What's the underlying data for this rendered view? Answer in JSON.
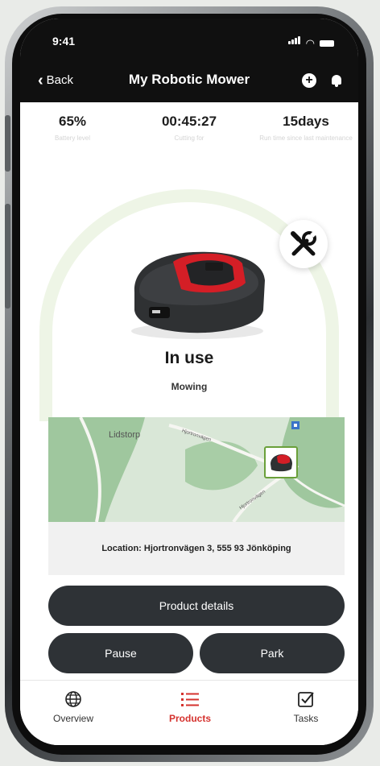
{
  "status_bar": {
    "time": "9:41"
  },
  "nav": {
    "back_label": "Back",
    "title": "My Robotic Mower"
  },
  "stats": [
    {
      "value": "65%",
      "label": "Battery level"
    },
    {
      "value": "00:45:27",
      "label": "Cutting for"
    },
    {
      "value": "15days",
      "label": "Run time since last maintenance"
    }
  ],
  "mower_status": {
    "state": "In use",
    "activity": "Mowing"
  },
  "map": {
    "place_label": "Lidstorp",
    "road_label_1": "Hjortronvägen",
    "road_label_2": "Hjortronvägen"
  },
  "location": {
    "text": "Location: Hjortronvägen 3, 555 93 Jönköping"
  },
  "actions": {
    "details": "Product details",
    "pause": "Pause",
    "park": "Park"
  },
  "tabs": [
    {
      "label": "Overview",
      "icon": "globe-icon"
    },
    {
      "label": "Products",
      "icon": "list-icon"
    },
    {
      "label": "Tasks",
      "icon": "checkbox-icon"
    }
  ],
  "colors": {
    "accent": "#d5322e",
    "button": "#2e3236",
    "arc": "#eef5e6",
    "map_pin": "#6aa03a"
  }
}
